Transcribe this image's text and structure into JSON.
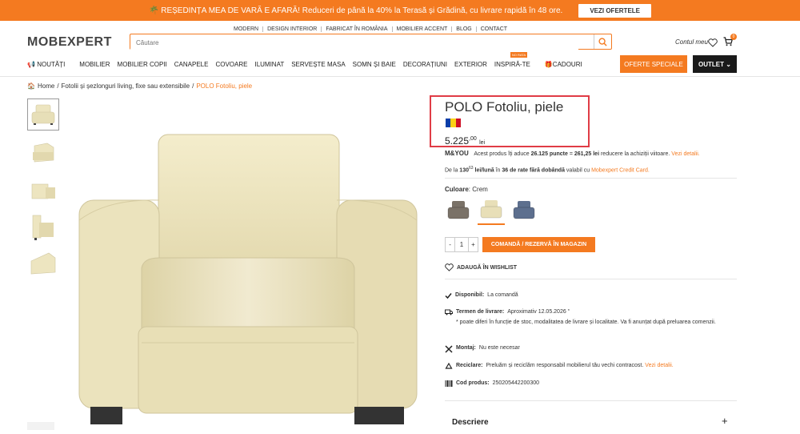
{
  "promo": {
    "text": "🌴 REȘEDINȚA MEA DE VARĂ E AFARĂ! Reduceri de până la 40% la Terasă și Grădină, cu livrare rapidă în 48 ore.",
    "button": "VEZI OFERTELE"
  },
  "header": {
    "logo": "MOBEXPERT",
    "top_links": [
      "MODERN",
      "DESIGN INTERIOR",
      "FABRICAT ÎN ROMÂNIA",
      "MOBILIER ACCENT",
      "BLOG",
      "CONTACT"
    ],
    "search_placeholder": "Căutare",
    "account": "Contul meu",
    "cart_count": "0"
  },
  "nav": {
    "items": [
      "NOUTĂȚI",
      "MOBILIER",
      "MOBILIER COPII",
      "CANAPELE",
      "COVOARE",
      "ILUMINAT",
      "SERVEȘTE MASA",
      "SOMN ȘI BAIE",
      "DECORAȚIUNI",
      "EXTERIOR",
      "INSPIRĂ-TE",
      "CADOURI"
    ],
    "new_badge": "NO RATA",
    "offers": "OFERTE SPECIALE",
    "outlet": "OUTLET"
  },
  "breadcrumb": {
    "home": "Home",
    "category": "Fotolii și șezlonguri living, fixe sau extensibile",
    "current": "POLO Fotoliu, piele"
  },
  "product": {
    "title": "POLO Fotoliu, piele",
    "flag_colors": [
      "#0b3ea8",
      "#fcd116",
      "#ce1126"
    ],
    "price_main": "5.225",
    "price_dec": ",00",
    "price_cur": "lei",
    "myou_logo": "M&YOU",
    "myou_text": "Acest produs îți aduce",
    "myou_points": "26.125 puncte",
    "myou_mid": "= ",
    "myou_value": "261,25 lei",
    "myou_rest": "reducere la achiziții viitoare.",
    "myou_link": "Vezi detalii.",
    "rate_pre": "De la",
    "rate_value": "130",
    "rate_sup": "63",
    "rate_unit": "lei/lună",
    "rate_mid": "în",
    "rate_months": "36 de rate fără dobândă",
    "rate_post": "valabil cu",
    "rate_link": "Mobexpert Credit Card.",
    "color_label": "Culoare",
    "color_value": "Crem",
    "swatches": [
      "#7a7268",
      "#e8dfb8",
      "#5d6f8e"
    ],
    "qty": "1",
    "order_button": "COMANDĂ / REZERVĂ ÎN MAGAZIN",
    "wishlist": "ADAUGĂ ÎN WISHLIST",
    "availability_label": "Disponibil:",
    "availability_value": "La comandă",
    "delivery_label": "Termen de livrare:",
    "delivery_value": "Aproximativ 12.05.2026",
    "delivery_note": "* poate diferi în funcție de stoc, modalitatea de livrare și localitate. Va fi anunțat după preluarea comenzii.",
    "assembly_label": "Montaj:",
    "assembly_value": "Nu este necesar",
    "recycle_label": "Reciclare:",
    "recycle_value": "Preluăm și reciclăm responsabil mobilierul tău vechi contracost.",
    "recycle_link": "Vezi detalii.",
    "code_label": "Cod produs:",
    "code_value": "250205442200300",
    "description": "Descriere"
  },
  "colors": {
    "accent": "#f47a20",
    "dark": "#1a1a1a",
    "highlight": "#e03c46",
    "leather": "#ede5c0"
  }
}
